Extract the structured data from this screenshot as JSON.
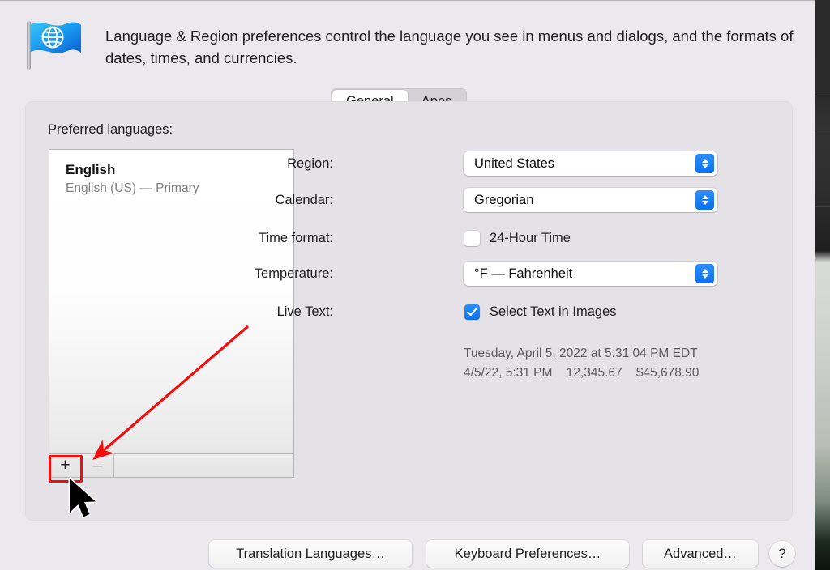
{
  "window": {
    "icon_name": "globe-flag-icon",
    "description": "Language & Region preferences control the language you see in menus and dialogs, and the formats of dates, times, and currencies."
  },
  "tabs": [
    {
      "label": "General",
      "active": true
    },
    {
      "label": "Apps",
      "active": false
    }
  ],
  "languages_section": {
    "label": "Preferred languages:",
    "items": [
      {
        "name": "English",
        "detail": "English (US) — Primary"
      }
    ],
    "toolbar": {
      "add_label": "+",
      "remove_label": "–",
      "add_highlighted": true,
      "remove_enabled": false
    }
  },
  "annotation": {
    "highlight_color": "#f20c0c",
    "arrow_color": "#f20c0c",
    "target": "add-language-button"
  },
  "settings": {
    "region": {
      "label": "Region:",
      "value": "United States",
      "control": "popup-button"
    },
    "calendar": {
      "label": "Calendar:",
      "value": "Gregorian",
      "control": "popup-button"
    },
    "time_format": {
      "label": "Time format:",
      "checkbox_label": "24-Hour Time",
      "checked": false
    },
    "temperature": {
      "label": "Temperature:",
      "value": "°F — Fahrenheit",
      "control": "popup-button"
    },
    "live_text": {
      "label": "Live Text:",
      "checkbox_label": "Select Text in Images",
      "checked": true
    }
  },
  "preview": {
    "line1": "Tuesday, April 5, 2022 at 5:31:04 PM EDT",
    "line2": "4/5/22, 5:31 PM    12,345.67    $45,678.90"
  },
  "bottom_buttons": [
    {
      "label": "Translation Languages…"
    },
    {
      "label": "Keyboard Preferences…"
    },
    {
      "label": "Advanced…"
    },
    {
      "label": "?"
    }
  ],
  "colors": {
    "accent_blue": "#0a72ef",
    "window_bg": "#ece9ee",
    "panel_bg": "#e4e1e7",
    "annotation_red": "#f20c0c"
  }
}
